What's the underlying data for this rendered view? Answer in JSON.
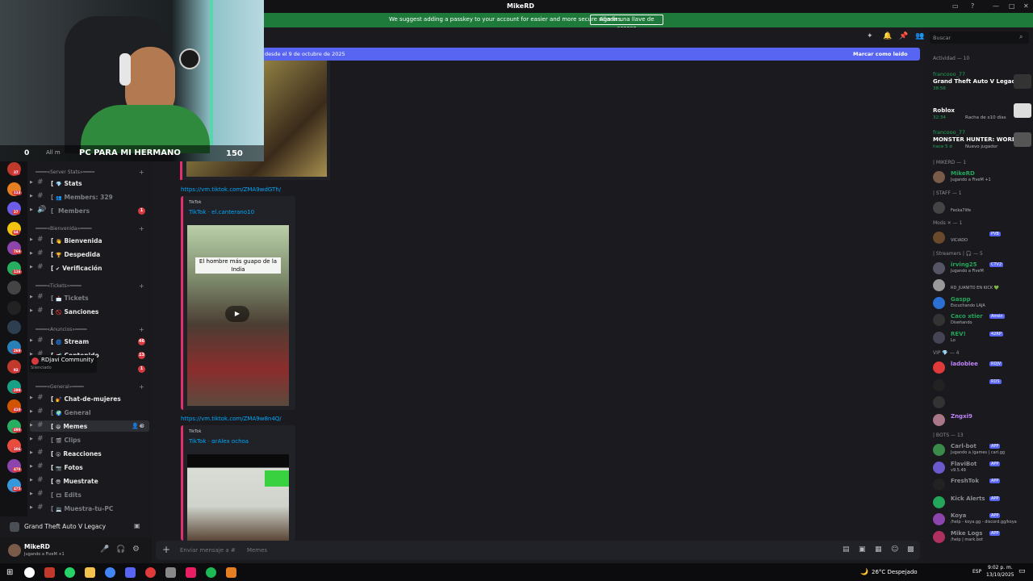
{
  "window": {
    "title": "MikeRD",
    "title_icon": "heart-icon"
  },
  "banner": {
    "message": "We suggest adding a passkey to your account for easier and more secure sign-ins.",
    "button": "Añadir una llave de acceso"
  },
  "stream_overlay": {
    "count": "0",
    "all_members_label": "All m",
    "title": "PC PARA MI HERMANO",
    "number": "150"
  },
  "server_badges": [
    "37",
    "113",
    "27",
    "64",
    "769",
    "116",
    "",
    "",
    "",
    "269",
    "92",
    "299",
    "410",
    "490",
    "306",
    "478",
    "475"
  ],
  "channels": [
    {
      "type": "category",
      "label": "━━━━«Server Stats»━━━━"
    },
    {
      "type": "channel",
      "label": "Stats",
      "emoji": "💎",
      "muted": false
    },
    {
      "type": "channel",
      "label": "Members: 329",
      "emoji": "👥",
      "muted": true
    },
    {
      "type": "channel",
      "label": "Members",
      "muted": true,
      "badge": "1",
      "voice": true
    },
    {
      "type": "category",
      "label": "━━━━«Bienvenida»━━━━"
    },
    {
      "type": "channel",
      "label": "Bienvenida",
      "emoji": "👋",
      "muted": false
    },
    {
      "type": "channel",
      "label": "Despedida",
      "emoji": "🏆",
      "muted": false
    },
    {
      "type": "channel",
      "label": "Verificación",
      "emoji": "✔",
      "muted": false
    },
    {
      "type": "category",
      "label": "━━━━«Tickets»━━━━"
    },
    {
      "type": "channel",
      "label": "Tickets",
      "emoji": "📩",
      "muted": true
    },
    {
      "type": "channel",
      "label": "Sanciones",
      "emoji": "🚫",
      "muted": false
    },
    {
      "type": "category",
      "label": "━━━━«Anuncios»━━━━"
    },
    {
      "type": "channel",
      "label": "Stream",
      "emoji": "🌀",
      "muted": false,
      "badge": "46"
    },
    {
      "type": "channel",
      "label": "Contenido",
      "emoji": "📢",
      "muted": false,
      "badge": "13"
    },
    {
      "type": "channel",
      "label": "",
      "muted": true,
      "badge": "1"
    },
    {
      "type": "category",
      "label": "━━━━«General»━━━━"
    },
    {
      "type": "channel",
      "label": "Chat-de-mujeres",
      "emoji": "💅",
      "muted": false
    },
    {
      "type": "channel",
      "label": "General",
      "emoji": "🌍",
      "muted": true
    },
    {
      "type": "channel",
      "label": "Memes",
      "emoji": "😆",
      "muted": false,
      "selected": true
    },
    {
      "type": "channel",
      "label": "Clips",
      "emoji": "🎬",
      "muted": true
    },
    {
      "type": "channel",
      "label": "Reacciones",
      "emoji": "😮",
      "muted": false
    },
    {
      "type": "channel",
      "label": "Fotos",
      "emoji": "📷",
      "muted": false
    },
    {
      "type": "channel",
      "label": "Muestrate",
      "emoji": "😎",
      "muted": false
    },
    {
      "type": "channel",
      "label": "Edits",
      "emoji": "🎞",
      "muted": true
    },
    {
      "type": "channel",
      "label": "Muestra-tu-PC",
      "emoji": "💻",
      "muted": true
    }
  ],
  "tooltip": {
    "name": "RDjavi Community",
    "status": "Silenciado"
  },
  "voice_activity": {
    "game": "Grand Theft Auto V Legacy"
  },
  "user_panel": {
    "name": "MikeRD",
    "status": "Jugando a FiveM +1"
  },
  "new_messages_bar": {
    "text": "desde el 9 de octubre de 2025",
    "action": "Marcar como leído"
  },
  "messages": [
    {
      "link": "https://vm.tiktok.com/ZMA9wdGTh/"
    },
    {
      "link": "https://vm.tiktok.com/ZMA9w8n4Q/"
    }
  ],
  "embeds": [
    {
      "provider": "TikTok",
      "author": "TikTok · el.canterano10",
      "caption": "El hombre más guapo de la India"
    },
    {
      "provider": "TikTok",
      "author": "TikTok · αrAlex ochoa"
    }
  ],
  "composer": {
    "placeholder": "Enviar mensaje a #",
    "channel": "Memes"
  },
  "search": {
    "placeholder": "Buscar"
  },
  "members": {
    "activity_header": "Actividad — 10",
    "activities": [
      {
        "user": "francooo_77",
        "game": "Grand Theft Auto V Legacy",
        "time": "38:56"
      },
      {
        "user": "",
        "game": "Roblox",
        "time": "32:34",
        "extra": "Racha de x10 días"
      },
      {
        "user": "francooo_77",
        "game": "MONSTER HUNTER: WORLD",
        "time": "hace 5 d",
        "extra": "Nuevo jugador"
      }
    ],
    "sections": [
      {
        "header": "| MIKERD — 1",
        "members": [
          {
            "name": "MikeRD",
            "status": "Jugando a FiveM +1",
            "color": "#23a55a"
          }
        ]
      },
      {
        "header": "| STAFF — 1",
        "members": [
          {
            "name": "",
            "status": "Fecka7life",
            "color": "#e03a3a"
          }
        ]
      },
      {
        "header": "Mods ✕ — 1",
        "members": [
          {
            "name": "",
            "status": "VICIADO",
            "color": "#5865f2",
            "tag": "PVB"
          }
        ]
      },
      {
        "header": "| Streamers | 🎧 — 5",
        "members": [
          {
            "name": "irving25",
            "status": "Jugando a FiveM",
            "color": "#23a55a",
            "tag": "CTV2"
          },
          {
            "name": "",
            "status": "RD_JUANITO EN KICK 💚",
            "color": "#b0b3b8"
          },
          {
            "name": "Gaspp",
            "status": "Escuchando LAJA",
            "color": "#23a55a"
          },
          {
            "name": "Caco xtier",
            "status": "Diseñando",
            "color": "#23a55a",
            "tag": "Amén"
          },
          {
            "name": "REV!",
            "status": "Lo",
            "color": "#23a55a",
            "tag": "42RP"
          }
        ]
      },
      {
        "header": "VIP 💎 — 4",
        "members": [
          {
            "name": "ladoblee",
            "status": "",
            "color": "#c084fc",
            "tag": "RDJV"
          },
          {
            "name": "",
            "status": "",
            "color": "#c084fc",
            "tag": "RDS"
          },
          {
            "name": "",
            "status": "",
            "color": "#c084fc"
          },
          {
            "name": "Zngxi9",
            "status": "",
            "color": "#c084fc"
          }
        ]
      },
      {
        "header": "| BOTS — 13",
        "members": [
          {
            "name": "Carl-bot",
            "status": "Jugando a /games | carl.gg",
            "color": "#8a8d93",
            "tag": "APP"
          },
          {
            "name": "FlaviBot",
            "status": "v9.5.49",
            "color": "#8a8d93",
            "tag": "APP"
          },
          {
            "name": "FreshTok",
            "status": "",
            "color": "#8a8d93",
            "tag": "APP"
          },
          {
            "name": "Kick Alerts",
            "status": "",
            "color": "#8a8d93",
            "tag": "APP"
          },
          {
            "name": "Koya",
            "status": "/help - koya.gg - discord.gg/koya",
            "color": "#8a8d93",
            "tag": "APP"
          },
          {
            "name": "Mike Logs",
            "status": "/help | mark.bot",
            "color": "#8a8d93",
            "tag": "APP"
          }
        ]
      }
    ]
  },
  "taskbar": {
    "weather": "26°C  Despejado",
    "language": "ESP",
    "time": "9:02 p. m.",
    "date": "13/10/2025"
  }
}
